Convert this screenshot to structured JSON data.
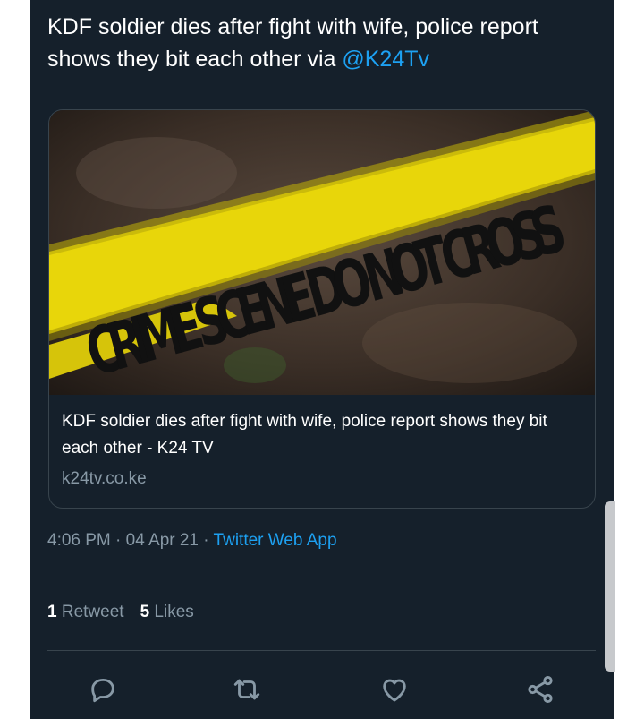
{
  "tweet": {
    "text": "KDF soldier dies after fight with wife, police report shows they bit each other via ",
    "mention": "@K24Tv"
  },
  "card": {
    "image_caption_text": "CRIME SCENE DO NOT CROSS",
    "title": "KDF soldier dies after fight with wife, police report shows they bit each other - K24 TV",
    "domain": "k24tv.co.ke"
  },
  "meta": {
    "time": "4:06 PM",
    "separator": " · ",
    "date": "04 Apr 21",
    "source": "Twitter Web App"
  },
  "stats": {
    "retweets_count": "1",
    "retweets_label": "Retweet",
    "likes_count": "5",
    "likes_label": "Likes"
  },
  "actions": {
    "reply_icon": "reply-icon",
    "retweet_icon": "retweet-icon",
    "like_icon": "heart-icon",
    "share_icon": "share-icon"
  },
  "colors": {
    "background": "#15202b",
    "text": "#ffffff",
    "secondary": "#8899a6",
    "accent": "#1da1f2",
    "tape": "#f4e60a"
  }
}
